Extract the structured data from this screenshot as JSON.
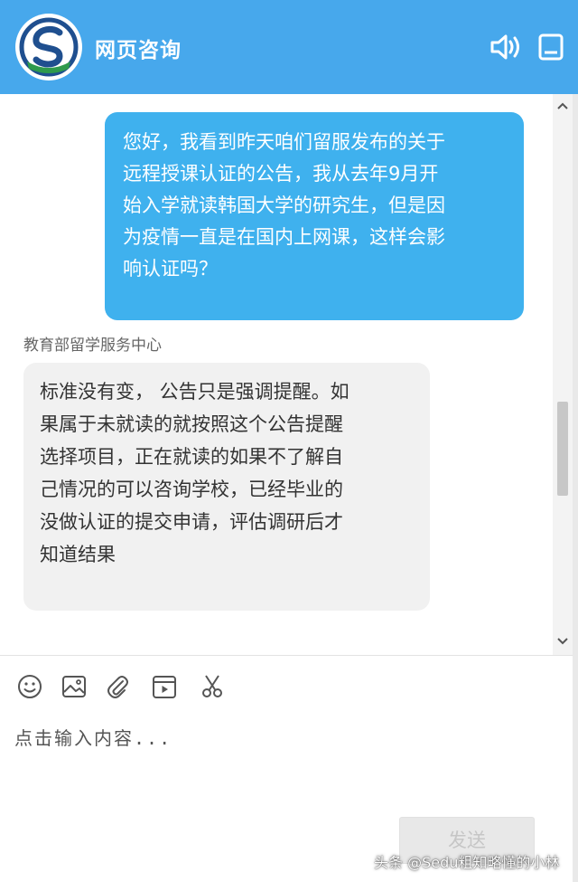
{
  "header": {
    "title": "网页咨询",
    "logo_icon": "organization-logo",
    "sound_icon": "speaker-icon",
    "window_icon": "window-icon",
    "background_color": "#47a8ec"
  },
  "messages": {
    "outgoing": {
      "lines": [
        "您好，我看到昨天咱们留服发布的关于",
        "远程授课认证的公告，我从去年9月开",
        "始入学就读韩国大学的研究生，但是因",
        "为疫情一直是在国内上网课，这样会影",
        "响认证吗？"
      ],
      "bubble_color": "#3fb1ee"
    },
    "incoming": {
      "sender": "教育部留学服务中心",
      "lines": [
        "标准没有变， 公告只是强调提醒。如",
        "果属于未就读的就按照这个公告提醒",
        "选择项目，正在就读的如果不了解自",
        "己情况的可以咨询学校，已经毕业的",
        "没做认证的提交申请，评估调研后才",
        "知道结果"
      ],
      "bubble_color": "#f1f1f1"
    }
  },
  "toolbar": {
    "items": [
      "emoji-icon",
      "image-icon",
      "attachment-icon",
      "video-icon",
      "scissors-icon"
    ]
  },
  "composer": {
    "placeholder": "点击输入内容...",
    "send_label": "发送"
  },
  "watermark": "头条 @Sedu粗知略懂的小林"
}
